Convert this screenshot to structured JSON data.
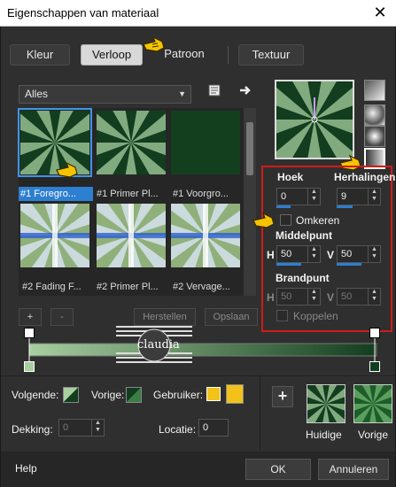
{
  "window": {
    "title": "Eigenschappen van materiaal",
    "close_glyph": "✕"
  },
  "tabs": [
    {
      "label": "Kleur",
      "active": false
    },
    {
      "label": "Verloop",
      "active": true
    },
    {
      "label": "Patroon",
      "active": false
    },
    {
      "label": "Textuur",
      "active": false
    }
  ],
  "library": {
    "filter_value": "Alles",
    "items": [
      {
        "label": "#1 Foregro...",
        "selected": true
      },
      {
        "label": "#1 Primer Pl...",
        "selected": false
      },
      {
        "label": "#1 Voorgro...",
        "selected": false
      },
      {
        "label": "#2 Fading F...",
        "selected": false
      },
      {
        "label": "#2 Primer Pl...",
        "selected": false
      },
      {
        "label": "#2 Vervage...",
        "selected": false
      }
    ],
    "add_label": "+",
    "remove_label": "-",
    "reset_label": "Herstellen",
    "save_label": "Opslaan"
  },
  "settings": {
    "angle_label": "Hoek",
    "angle_value": "0",
    "repeats_label": "Herhalingen",
    "repeats_value": "9",
    "invert_label": "Omkeren",
    "invert_checked": false,
    "midpoint_label": "Middelpunt",
    "midpoint_h_label": "H",
    "midpoint_h_value": "50",
    "midpoint_v_label": "V",
    "midpoint_v_value": "50",
    "focal_label": "Brandpunt",
    "focal_h_label": "H",
    "focal_h_value": "50",
    "focal_v_label": "V",
    "focal_v_value": "50",
    "link_label": "Koppelen",
    "link_checked": false
  },
  "watermark": {
    "text": "claudia"
  },
  "bottom": {
    "next_label": "Volgende:",
    "prev_label": "Vorige:",
    "user_label": "Gebruiker:",
    "opacity_label": "Dekking:",
    "opacity_value": "0",
    "location_label": "Locatie:",
    "location_value": "0",
    "add_label": "+",
    "current_label": "Huidige",
    "previous_label": "Vorige"
  },
  "footer": {
    "help_label": "Help",
    "ok_label": "OK",
    "cancel_label": "Annuleren"
  },
  "colors": {
    "accent": "#2d7fd1",
    "highlight_red": "#d11b1b",
    "gradient_light": "#a8cfa0",
    "gradient_dark": "#123d1e",
    "user_swatch": "#f2c21b",
    "cursor_yellow": "#f5c400"
  }
}
